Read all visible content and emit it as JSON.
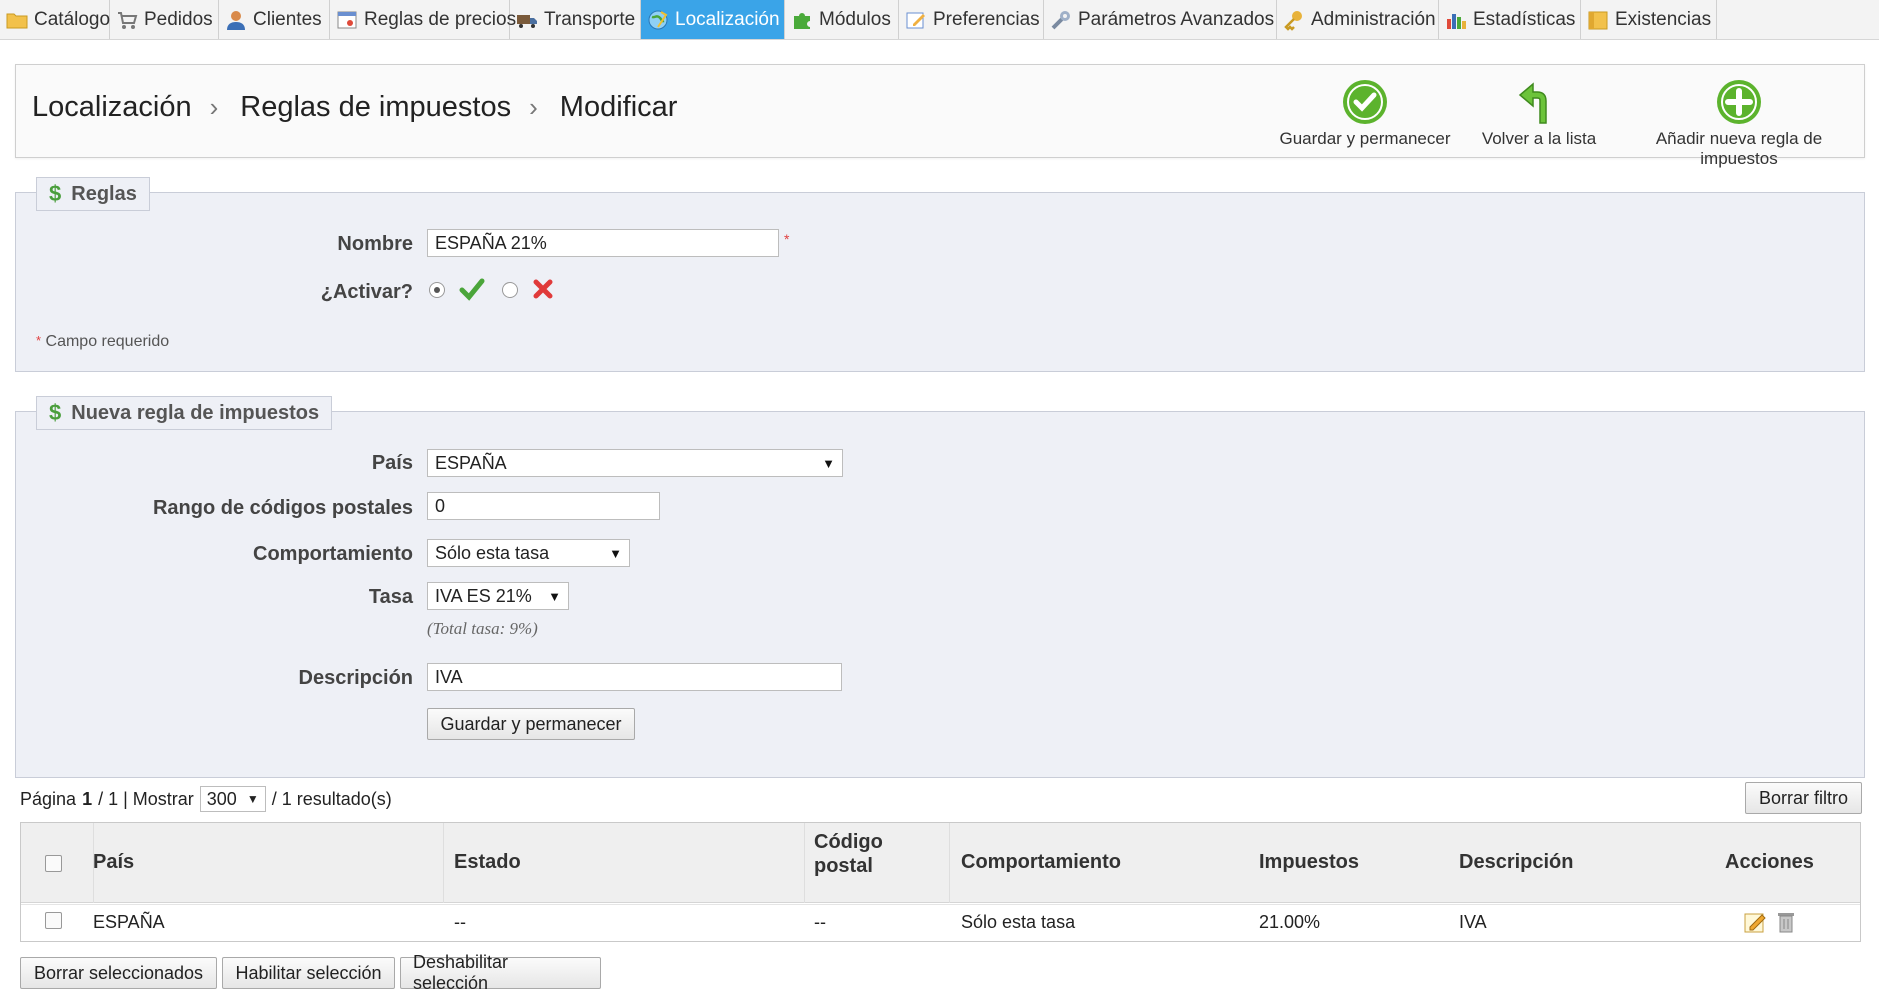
{
  "nav": {
    "tabs": [
      {
        "label": "Catálogo",
        "icon": "folder-icon"
      },
      {
        "label": "Pedidos",
        "icon": "cart-icon"
      },
      {
        "label": "Clientes",
        "icon": "user-icon"
      },
      {
        "label": "Reglas de precios",
        "icon": "price-rules-icon"
      },
      {
        "label": "Transporte",
        "icon": "truck-icon"
      },
      {
        "label": "Localización",
        "icon": "globe-icon"
      },
      {
        "label": "Módulos",
        "icon": "puzzle-icon"
      },
      {
        "label": "Preferencias",
        "icon": "preferences-icon"
      },
      {
        "label": "Parámetros Avanzados",
        "icon": "wrench-icon"
      },
      {
        "label": "Administración",
        "icon": "key-icon"
      },
      {
        "label": "Estadísticas",
        "icon": "bar-chart-icon"
      },
      {
        "label": "Existencias",
        "icon": "box-icon"
      }
    ],
    "active_tab": "Localización"
  },
  "breadcrumb": {
    "items": [
      "Localización",
      "Reglas de impuestos",
      "Modificar"
    ],
    "separator": "›"
  },
  "toolbar": {
    "save_stay": "Guardar y permanecer",
    "back_list": "Volver a la lista",
    "add_new": "Añadir nueva regla de impuestos"
  },
  "rules_panel": {
    "legend": "Reglas",
    "name_label": "Nombre",
    "name_value": "ESPAÑA 21%",
    "required_mark": "*",
    "activate_label": "¿Activar?",
    "activate_value": "yes",
    "required_note": "Campo requerido"
  },
  "new_rule_panel": {
    "legend": "Nueva regla de impuestos",
    "country_label": "País",
    "country_value": "ESPAÑA",
    "zip_label": "Rango de códigos postales",
    "zip_value": "0",
    "behavior_label": "Comportamiento",
    "behavior_value": "Sólo esta tasa",
    "rate_label": "Tasa",
    "rate_value": "IVA ES 21%",
    "rate_note": "(Total tasa: 9%)",
    "description_label": "Descripción",
    "description_value": "IVA",
    "save_button": "Guardar y permanecer"
  },
  "pager": {
    "page_label": "Página",
    "page": "1",
    "pages": "/ 1 | Mostrar",
    "per_page": "300",
    "results": "/ 1 resultado(s)",
    "reset_filter": "Borrar filtro"
  },
  "table": {
    "columns": [
      "País",
      "Estado",
      "Código postal",
      "Comportamiento",
      "Impuestos",
      "Descripción",
      "Acciones"
    ],
    "rows": [
      {
        "country": "ESPAÑA",
        "state": "--",
        "zip": "--",
        "behavior": "Sólo esta tasa",
        "tax": "21.00%",
        "description": "IVA"
      }
    ]
  },
  "bulk": {
    "delete": "Borrar seleccionados",
    "enable": "Habilitar selección",
    "disable": "Deshabilitar selección"
  },
  "colors": {
    "active_tab": "#3aa4e8",
    "panel_bg": "#eef0f6",
    "success_green": "#5cb32d"
  }
}
